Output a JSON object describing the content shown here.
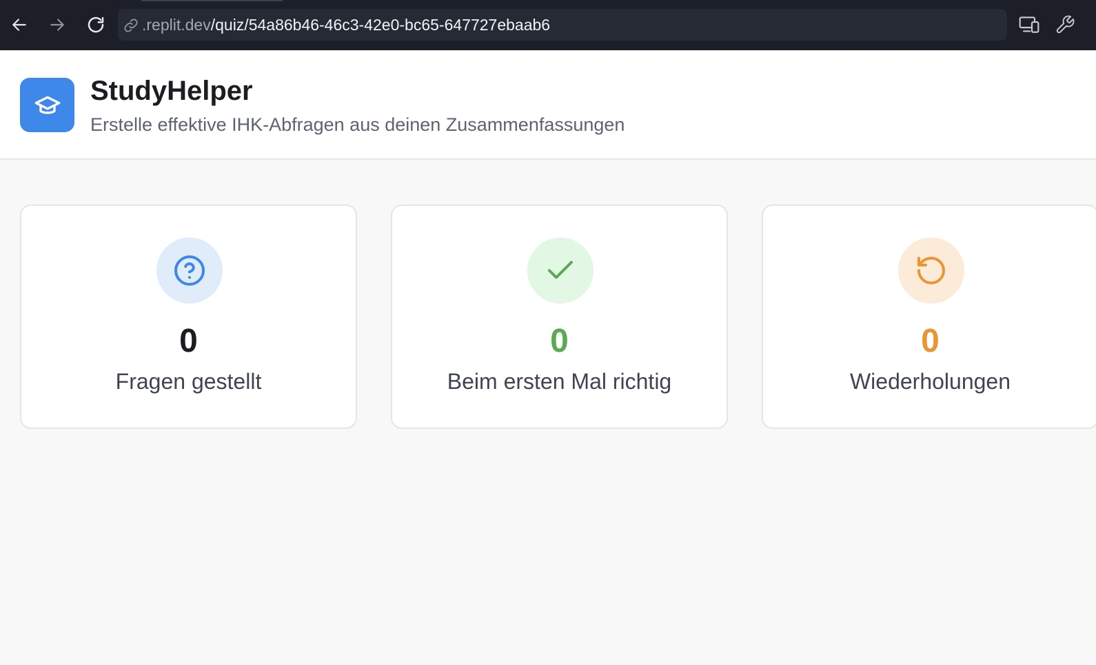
{
  "browser": {
    "url_domain": ".replit.dev",
    "url_path": "/quiz/54a86b46-46c3-42e0-bc65-647727ebaab6",
    "icons": {
      "back": "arrow-left-icon",
      "forward": "arrow-right-icon",
      "reload": "reload-icon",
      "link": "link-icon",
      "devices": "devices-icon",
      "tools": "wrench-icon"
    }
  },
  "header": {
    "title": "StudyHelper",
    "subtitle": "Erstelle effektive IHK-Abfragen aus deinen Zusammenfassungen",
    "logo_icon": "graduation-cap-icon",
    "logo_color": "#3d88e8"
  },
  "stats": [
    {
      "value": "0",
      "label": "Fragen gestellt",
      "icon": "question-circle-icon",
      "color": "#3d88e8",
      "bg": "#e1ecfb",
      "value_color": "#1c1d20"
    },
    {
      "value": "0",
      "label": "Beim ersten Mal richtig",
      "icon": "check-icon",
      "color": "#5aaa52",
      "bg": "#e2f7e4",
      "value_color": "#5aaa52"
    },
    {
      "value": "0",
      "label": "Wiederholungen",
      "icon": "rotate-ccw-icon",
      "color": "#ea9534",
      "bg": "#fcebd9",
      "value_color": "#ea9534"
    }
  ]
}
